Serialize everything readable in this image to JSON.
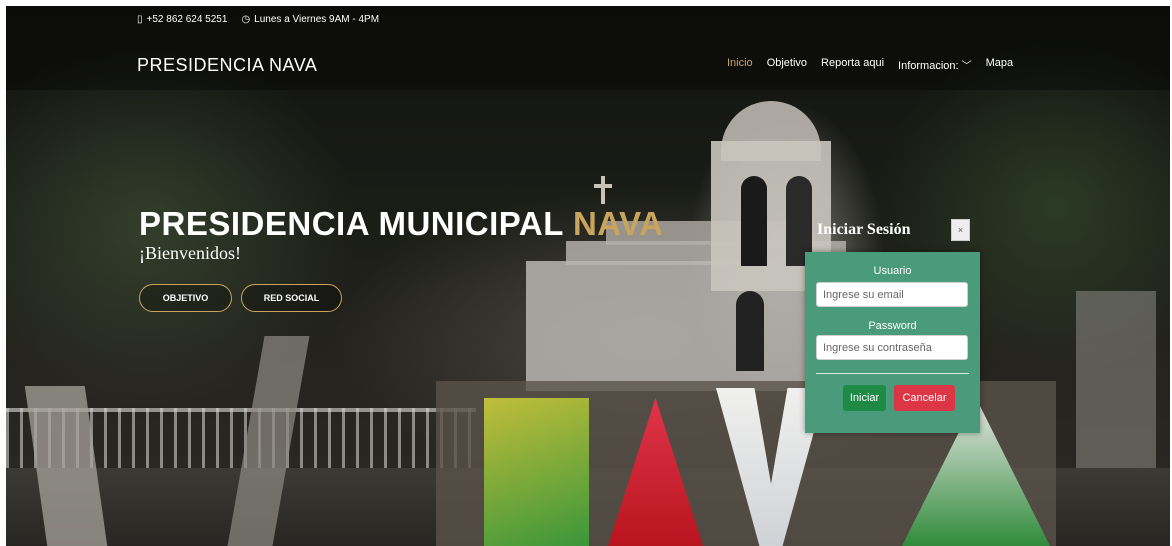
{
  "topbar": {
    "phone_icon": "phone-icon",
    "phone": "+52 862 624 5251",
    "clock_icon": "clock-icon",
    "hours": "Lunes a Viernes 9AM - 4PM"
  },
  "brand": "PRESIDENCIA NAVA",
  "nav": {
    "items": [
      {
        "label": "Inicio",
        "active": true
      },
      {
        "label": "Objetivo"
      },
      {
        "label": "Reporta aqui"
      },
      {
        "label": "Informacion:",
        "dropdown": true
      },
      {
        "label": "Mapa"
      }
    ]
  },
  "hero": {
    "title_main": "PRESIDENCIA MUNICIPAL ",
    "title_accent": "NAVA",
    "subtitle": "¡Bienvenidos!",
    "buttons": {
      "objetivo": "OBJETIVO",
      "red_social": "RED SOCIAL"
    }
  },
  "login": {
    "title": "Iniciar Sesión",
    "close": "×",
    "user_label": "Usuario",
    "user_placeholder": "Ingrese su email",
    "pass_label": "Password",
    "pass_placeholder": "Ingrese su contraseña",
    "submit": "Iniciar",
    "cancel": "Cancelar"
  },
  "colors": {
    "accent": "#c9a45c",
    "modal_bg": "#4a9a7c",
    "submit_bg": "#1f8a45",
    "cancel_bg": "#dc3545"
  }
}
